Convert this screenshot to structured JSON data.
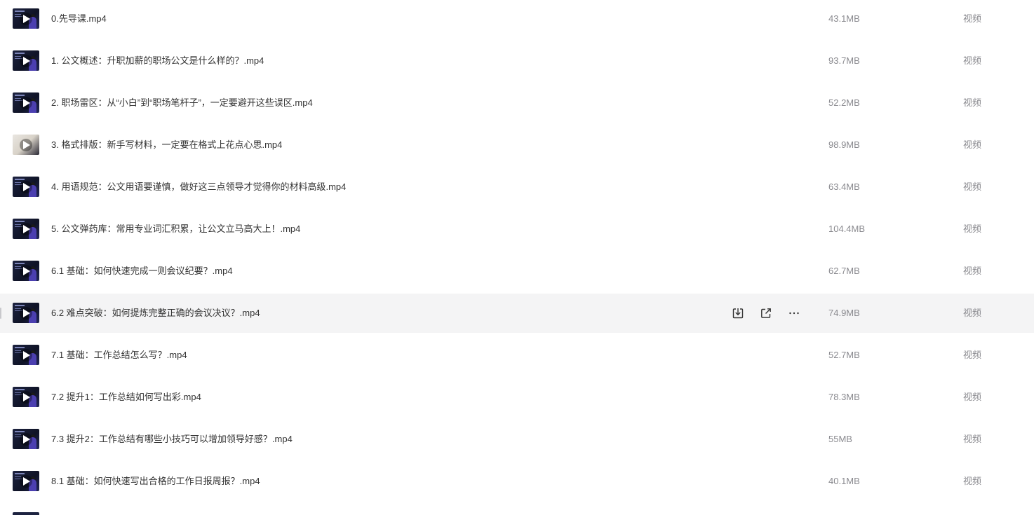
{
  "files": [
    {
      "name": "0.先导课.mp4",
      "size": "43.1MB",
      "type": "视频"
    },
    {
      "name": "1. 公文概述：升职加薪的职场公文是什么样的？.mp4",
      "size": "93.7MB",
      "type": "视频"
    },
    {
      "name": "2. 职场雷区：从“小白”到“职场笔杆子”，一定要避开这些误区.mp4",
      "size": "52.2MB",
      "type": "视频"
    },
    {
      "name": "3. 格式排版：新手写材料，一定要在格式上花点心思.mp4",
      "size": "98.9MB",
      "type": "视频"
    },
    {
      "name": "4. 用语规范：公文用语要谨慎，做好这三点领导才觉得你的材料高级.mp4",
      "size": "63.4MB",
      "type": "视频"
    },
    {
      "name": "5. 公文弹药库：常用专业词汇积累，让公文立马高大上！.mp4",
      "size": "104.4MB",
      "type": "视频"
    },
    {
      "name": "6.1 基础：如何快速完成一则会议纪要？.mp4",
      "size": "62.7MB",
      "type": "视频"
    },
    {
      "name": "6.2 难点突破：如何提炼完整正确的会议决议？.mp4",
      "size": "74.9MB",
      "type": "视频"
    },
    {
      "name": "7.1 基础：工作总结怎么写？.mp4",
      "size": "52.7MB",
      "type": "视频"
    },
    {
      "name": "7.2 提升1：工作总结如何写出彩.mp4",
      "size": "78.3MB",
      "type": "视频"
    },
    {
      "name": "7.3 提升2：工作总结有哪些小技巧可以增加领导好感？.mp4",
      "size": "55MB",
      "type": "视频"
    },
    {
      "name": "8.1 基础：如何快速写出合格的工作日报周报？.mp4",
      "size": "40.1MB",
      "type": "视频"
    }
  ],
  "hover_row_index": 7,
  "row_actions": [
    "download-icon",
    "share-icon",
    "more-icon"
  ],
  "colors": {
    "hover_bg": "#f4f4f5",
    "text": "#333333",
    "muted": "#8a8a8f"
  }
}
